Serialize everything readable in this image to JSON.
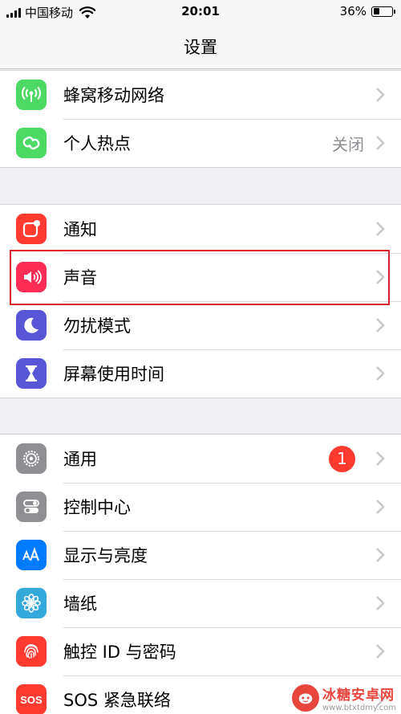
{
  "status_bar": {
    "carrier": "中国移动",
    "time": "20:01",
    "battery_percent": "36%",
    "battery_level": 0.36
  },
  "nav": {
    "title": "设置"
  },
  "groups": [
    {
      "items": [
        {
          "label": "蜂窝移动网络",
          "icon": "antenna-icon",
          "color": "#4cd964"
        },
        {
          "label": "个人热点",
          "value": "关闭",
          "icon": "link-icon",
          "color": "#4cd964"
        }
      ]
    },
    {
      "items": [
        {
          "label": "通知",
          "icon": "notification-icon",
          "color": "#ff3b30"
        },
        {
          "label": "声音",
          "icon": "speaker-icon",
          "color": "#ff2d55"
        },
        {
          "label": "勿扰模式",
          "icon": "moon-icon",
          "color": "#5856d6"
        },
        {
          "label": "屏幕使用时间",
          "icon": "hourglass-icon",
          "color": "#5856d6"
        }
      ]
    },
    {
      "items": [
        {
          "label": "通用",
          "badge": "1",
          "icon": "gear-icon",
          "color": "#8e8e93"
        },
        {
          "label": "控制中心",
          "icon": "toggles-icon",
          "color": "#8e8e93"
        },
        {
          "label": "显示与亮度",
          "icon": "text-size-icon",
          "color": "#007aff"
        },
        {
          "label": "墙纸",
          "icon": "flower-icon",
          "color": "#34aadc"
        },
        {
          "label": "触控 ID 与密码",
          "icon": "fingerprint-icon",
          "color": "#ff3b30"
        },
        {
          "label": "SOS 紧急联络",
          "icon": "sos-icon",
          "color": "#ff3b30",
          "icon_text": "SOS"
        }
      ]
    }
  ],
  "watermark": {
    "name": "冰糖安卓网",
    "url": "www.btxtdmy.com"
  }
}
